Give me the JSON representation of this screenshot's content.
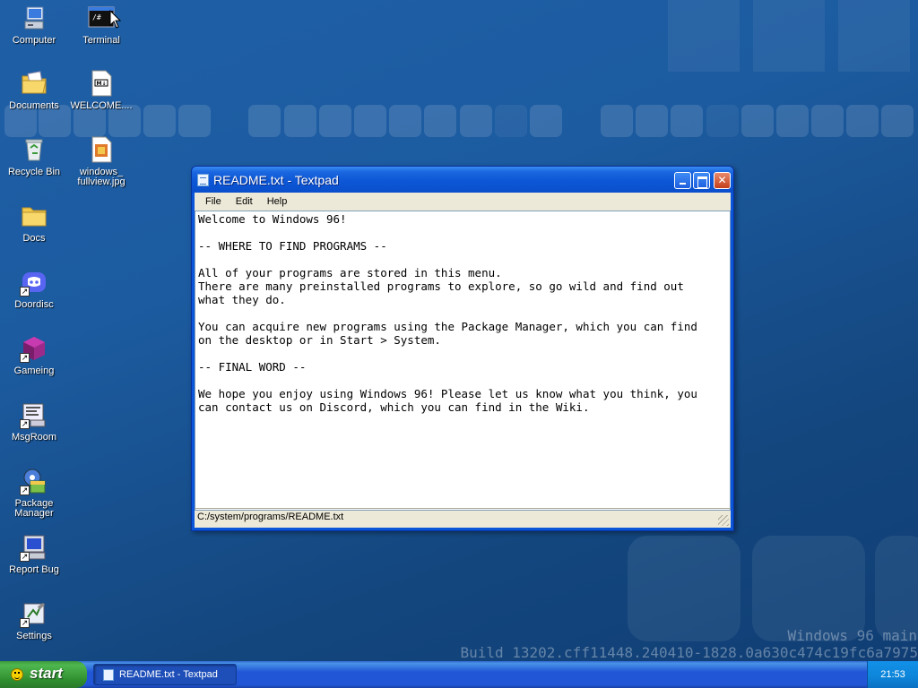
{
  "desktop": {
    "icons": [
      {
        "label": "Computer",
        "icon": "computer-icon"
      },
      {
        "label": "Terminal",
        "icon": "terminal-icon"
      },
      {
        "label": "Documents",
        "icon": "documents-folder-icon"
      },
      {
        "label": "WELCOME....",
        "icon": "markdown-file-icon"
      },
      {
        "label": "Recycle Bin",
        "icon": "recycle-bin-icon"
      },
      {
        "label": "windows_ fullview.jpg",
        "icon": "image-file-icon"
      },
      {
        "label": "Docs",
        "icon": "folder-icon"
      },
      {
        "label": "Doordisc",
        "icon": "discord-icon"
      },
      {
        "label": "Gameing",
        "icon": "gaming-cube-icon"
      },
      {
        "label": "MsgRoom",
        "icon": "msgroom-icon"
      },
      {
        "label": "Package Manager",
        "icon": "package-manager-icon"
      },
      {
        "label": "Report Bug",
        "icon": "report-bug-icon"
      },
      {
        "label": "Settings",
        "icon": "settings-icon"
      }
    ]
  },
  "window": {
    "title": "README.txt - Textpad",
    "menu": [
      "File",
      "Edit",
      "Help"
    ],
    "content": "Welcome to Windows 96!\n\n-- WHERE TO FIND PROGRAMS --\n\nAll of your programs are stored in this menu.\nThere are many preinstalled programs to explore, so go wild and find out\nwhat they do.\n\nYou can acquire new programs using the Package Manager, which you can find\non the desktop or in Start > System.\n\n-- FINAL WORD --\n\nWe hope you enjoy using Windows 96! Please let us know what you think, you\ncan contact us on Discord, which you can find in the Wiki.",
    "status_path": "C:/system/programs/README.txt"
  },
  "build": {
    "line1": "Windows 96 main",
    "line2": "Build 13202.cff11448.240410-1828.0a630c474c19fc6a7975"
  },
  "taskbar": {
    "start_label": "start",
    "task_label": "README.txt - Textpad",
    "clock": "21:53"
  },
  "colors": {
    "desktop": "#1c5ba0",
    "titlebar": "#0d57d6",
    "taskbar": "#2157d7",
    "start": "#3c9a3c"
  }
}
